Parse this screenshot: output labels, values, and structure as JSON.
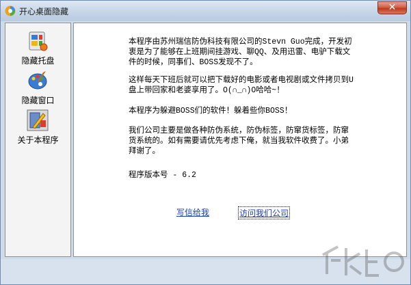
{
  "window": {
    "title": "开心桌面隐藏",
    "close_symbol": "✕"
  },
  "sidebar": {
    "items": [
      {
        "label": "隐藏托盘",
        "icon": "tray-hide-icon"
      },
      {
        "label": "隐藏窗口",
        "icon": "palette-window-icon"
      },
      {
        "label": "关于本程序",
        "icon": "about-program-icon"
      }
    ]
  },
  "content": {
    "paragraphs": [
      "本程序由苏州瑞信防伪科技有限公司的Stevn Guo完成，开发初衷是为了能够在上班期间挂游戏、聊QQ、及用迅雷、电驴下载文件的时候，同事们、BOSS发现不了。",
      "这样每天下班后就可以把下载好的电影或者电视剧或文件拷贝到U盘上带回家和老婆享用了。O(∩_∩)O哈哈~！",
      "本程序为躲避BOSS们的软件！躲着些你BOSS！",
      "我们公司主要是做各种防伪系统，防伪标签，防窜货标签，防窜货系统的。如有需要请优先考虑下俺，就当我软件收费了。小弟拜谢了。",
      "程序版本号 - 6.2"
    ],
    "links": {
      "write": "写信给我",
      "visit": "访问我们公司"
    }
  },
  "colors": {
    "frame": "#cfdbe9",
    "link": "#1a3fb8",
    "close": "#c2391d"
  }
}
